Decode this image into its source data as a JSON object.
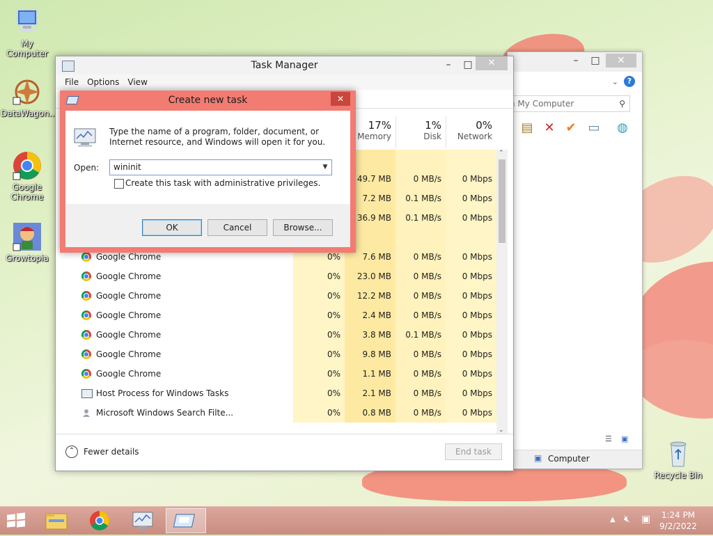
{
  "desktop": {
    "icons": [
      {
        "label": "My Computer",
        "icon": "computer-icon"
      },
      {
        "label": "DataWagon...",
        "icon": "datawagon-icon"
      },
      {
        "label": "Google Chrome",
        "icon": "chrome-icon"
      },
      {
        "label": "Growtopia",
        "icon": "growtopia-icon"
      },
      {
        "label": "Recycle Bin",
        "icon": "recycle-bin-icon"
      }
    ]
  },
  "explorer": {
    "search_placeholder": "h My Computer",
    "status_item": "Computer"
  },
  "task_manager": {
    "title": "Task Manager",
    "menu": [
      "File",
      "Options",
      "View"
    ],
    "columns": [
      {
        "pct": "17%",
        "name": "Memory"
      },
      {
        "pct": "1%",
        "name": "Disk"
      },
      {
        "pct": "0%",
        "name": "Network"
      }
    ],
    "partial_rows": [
      {
        "memory": "49.7 MB",
        "disk": "0 MB/s",
        "network": "0 Mbps"
      },
      {
        "memory": "7.2 MB",
        "disk": "0.1 MB/s",
        "network": "0 Mbps"
      },
      {
        "memory": "36.9 MB",
        "disk": "0.1 MB/s",
        "network": "0 Mbps"
      }
    ],
    "rows": [
      {
        "name": "Google Chrome",
        "icon": "chrome",
        "cpu": "0%",
        "memory": "7.6 MB",
        "disk": "0 MB/s",
        "network": "0 Mbps"
      },
      {
        "name": "Google Chrome",
        "icon": "chrome",
        "cpu": "0%",
        "memory": "23.0 MB",
        "disk": "0 MB/s",
        "network": "0 Mbps"
      },
      {
        "name": "Google Chrome",
        "icon": "chrome",
        "cpu": "0%",
        "memory": "12.2 MB",
        "disk": "0 MB/s",
        "network": "0 Mbps"
      },
      {
        "name": "Google Chrome",
        "icon": "chrome",
        "cpu": "0%",
        "memory": "2.4 MB",
        "disk": "0 MB/s",
        "network": "0 Mbps"
      },
      {
        "name": "Google Chrome",
        "icon": "chrome",
        "cpu": "0%",
        "memory": "3.8 MB",
        "disk": "0.1 MB/s",
        "network": "0 Mbps"
      },
      {
        "name": "Google Chrome",
        "icon": "chrome",
        "cpu": "0%",
        "memory": "9.8 MB",
        "disk": "0 MB/s",
        "network": "0 Mbps"
      },
      {
        "name": "Google Chrome",
        "icon": "chrome",
        "cpu": "0%",
        "memory": "1.1 MB",
        "disk": "0 MB/s",
        "network": "0 Mbps"
      },
      {
        "name": "Host Process for Windows Tasks",
        "icon": "host",
        "cpu": "0%",
        "memory": "2.1 MB",
        "disk": "0 MB/s",
        "network": "0 Mbps"
      },
      {
        "name": "Microsoft Windows Search Filte...",
        "icon": "search",
        "cpu": "0%",
        "memory": "0.8 MB",
        "disk": "0 MB/s",
        "network": "0 Mbps"
      }
    ],
    "fewer_details": "Fewer details",
    "end_task": "End task"
  },
  "dialog": {
    "title": "Create new task",
    "description": "Type the name of a program, folder, document, or Internet resource, and Windows will open it for you.",
    "open_label": "Open:",
    "open_value": "wininit",
    "admin_checkbox_label": "Create this task with administrative privileges.",
    "admin_checked": false,
    "ok": "OK",
    "cancel": "Cancel",
    "browse": "Browse..."
  },
  "taskbar": {
    "time": "1:24 PM",
    "date": "9/2/2022"
  }
}
